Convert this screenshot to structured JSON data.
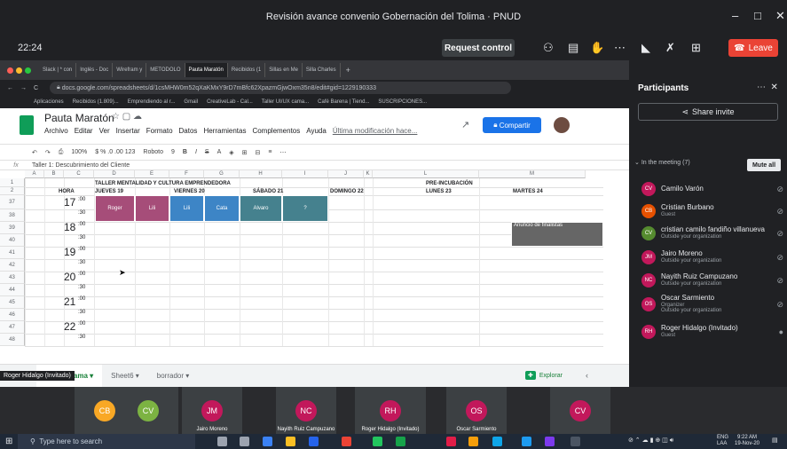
{
  "window": {
    "title": "Revisión avance convenio Gobernación del Tolima · PNUD"
  },
  "meet": {
    "time": "22:24",
    "request_control": "Request control",
    "leave": "Leave",
    "self_label": "Roger Hidalgo (Invitado)"
  },
  "browser": {
    "tabs": [
      "Slack | * con",
      "Inglés - Doc",
      "Wirefram y",
      "METODOLO",
      "Pauta Maratón",
      "Recibidos (1",
      "Sillas en Me",
      "Silla Charles"
    ],
    "url": "docs.google.com/spreadsheets/d/1csMHW0m52qXaKMxY9rD7mBfc62XpazmGjwOxm35n8/edit#gid=1229190333",
    "bookmarks": [
      "Aplicaciones",
      "Recibidos (1.809)...",
      "Emprendiendo al r...",
      "Gmail",
      "CreativeLab - Cal...",
      "Taller UI/UX cama...",
      "Café Barena | Tiend...",
      "SUSCRIPCIONES..."
    ]
  },
  "sheet": {
    "title": "Pauta Maratón",
    "menu": [
      "Archivo",
      "Editar",
      "Ver",
      "Insertar",
      "Formato",
      "Datos",
      "Herramientas",
      "Complementos",
      "Ayuda"
    ],
    "last_edit": "Última modificación hace...",
    "share": "Compartir",
    "zoom": "100%",
    "font": "Roboto",
    "font_size": "9",
    "formula": "Taller 1: Descubrimiento del Cliente",
    "cols": [
      "A",
      "B",
      "C",
      "D",
      "E",
      "F",
      "G",
      "H",
      "I",
      "J",
      "K",
      "L",
      "M"
    ],
    "row_nums": [
      "1",
      "2",
      "37",
      "38",
      "39",
      "40",
      "41",
      "42",
      "43",
      "44",
      "45",
      "46",
      "47",
      "48"
    ],
    "heading": "TALLER MENTALIDAD Y CULTURA EMPRENDEDORA",
    "preinc": "PRE-INCUBACIÓN",
    "hora": "HORA",
    "days": [
      "JUEVES 19",
      "VIERNES 20",
      "SÁBADO 21",
      "DOMINGO 22",
      "LUNES 23",
      "MARTES 24"
    ],
    "hours": [
      "17",
      "18",
      "19",
      "20",
      "21",
      "22"
    ],
    "min00": ":00",
    "min30": ":30",
    "blocks": [
      "Roger",
      "Lili",
      "Lili",
      "Cata",
      "Alvaro",
      "?"
    ],
    "finalists": "Anuncio de finalistas",
    "sheet_tabs": [
      "Cronograma",
      "Sheet6",
      "borrador"
    ],
    "explore": "Explorar"
  },
  "participants": {
    "title": "Participants",
    "share_invite": "Share invite",
    "in_meeting": "In the meeting (7)",
    "mute_all": "Mute all",
    "list": [
      {
        "initials": "CV",
        "name": "Camilo Varón",
        "sub": "",
        "color": "#c2185b"
      },
      {
        "initials": "CB",
        "name": "Cristian Burbano",
        "sub": "Guest",
        "color": "#e65100"
      },
      {
        "initials": "CV",
        "name": "cristian camilo fandiño villanueva",
        "sub": "Outside your organization",
        "color": "#558b2f"
      },
      {
        "initials": "JM",
        "name": "Jairo Moreno",
        "sub": "Outside your organization",
        "color": "#c2185b"
      },
      {
        "initials": "NC",
        "name": "Nayith Ruiz Campuzano",
        "sub": "Outside your organization",
        "color": "#c2185b"
      },
      {
        "initials": "OS",
        "name": "Oscar Sarmiento",
        "sub": "Organizer",
        "sub2": "Outside your organization",
        "color": "#c2185b"
      },
      {
        "initials": "RH",
        "name": "Roger Hidalgo (Invitado)",
        "sub": "Guest",
        "color": "#c2185b"
      }
    ]
  },
  "tiles": [
    {
      "initials": "CB",
      "label": "",
      "color": "#f9a825"
    },
    {
      "initials": "CV",
      "label": "",
      "color": "#7cb342"
    },
    {
      "initials": "JM",
      "label": "Jairo Moreno",
      "color": "#c2185b"
    },
    {
      "initials": "NC",
      "label": "Nayith Ruiz Campuzano",
      "color": "#c2185b"
    },
    {
      "initials": "RH",
      "label": "Roger Hidalgo (Invitado)",
      "color": "#c2185b"
    },
    {
      "initials": "OS",
      "label": "Oscar Sarmiento",
      "color": "#c2185b"
    },
    {
      "initials": "CV",
      "label": "",
      "color": "#c2185b"
    }
  ],
  "taskbar": {
    "search": "Type here to search",
    "lang": "ENG",
    "lang2": "LAA",
    "clock": "9:22 AM",
    "date": "19-Nov-20"
  }
}
